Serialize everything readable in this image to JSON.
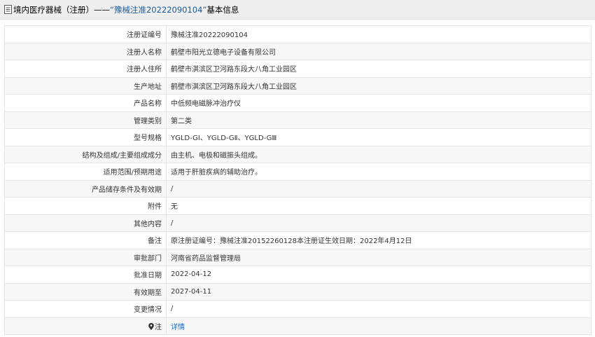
{
  "header": {
    "prefix": "境内医疗器械（注册）——",
    "quoted": "“豫械注准20222090104”",
    "suffix": "基本信息"
  },
  "rows": [
    {
      "label": "注册证编号",
      "value": "豫械注准20222090104"
    },
    {
      "label": "注册人名称",
      "value": "鹤壁市阳光立德电子设备有限公司"
    },
    {
      "label": "注册人住所",
      "value": "鹤壁市淇滨区卫河路东段大八角工业园区"
    },
    {
      "label": "生产地址",
      "value": "鹤壁市淇滨区卫河路东段大八角工业园区"
    },
    {
      "label": "产品名称",
      "value": "中低频电磁脉冲治疗仪"
    },
    {
      "label": "管理类别",
      "value": "第二类"
    },
    {
      "label": "型号规格",
      "value": "YGLD-GⅠ、YGLD-GⅡ、YGLD-GⅢ"
    },
    {
      "label": "结构及组成/主要组成成分",
      "value": "由主机、电极和磁振头组成。"
    },
    {
      "label": "适用范围/预期用途",
      "value": "适用于肝脏疾病的辅助治疗。"
    },
    {
      "label": "产品储存条件及有效期",
      "value": "/"
    },
    {
      "label": "附件",
      "value": "无"
    },
    {
      "label": "其他内容",
      "value": "/"
    },
    {
      "label": "备注",
      "value": "原注册证编号：豫械注准20152260128本注册证生效日期：2022年4月12日"
    },
    {
      "label": "审批部门",
      "value": "河南省药品监督管理局"
    },
    {
      "label": "批准日期",
      "value": "2022-04-12"
    },
    {
      "label": "有效期至",
      "value": "2027-04-11"
    },
    {
      "label": "变更情况",
      "value": "/"
    }
  ],
  "note": {
    "label": "注",
    "link": "详情"
  },
  "colors": {
    "link": "#1a66c2",
    "quoted": "#1a5a96"
  }
}
